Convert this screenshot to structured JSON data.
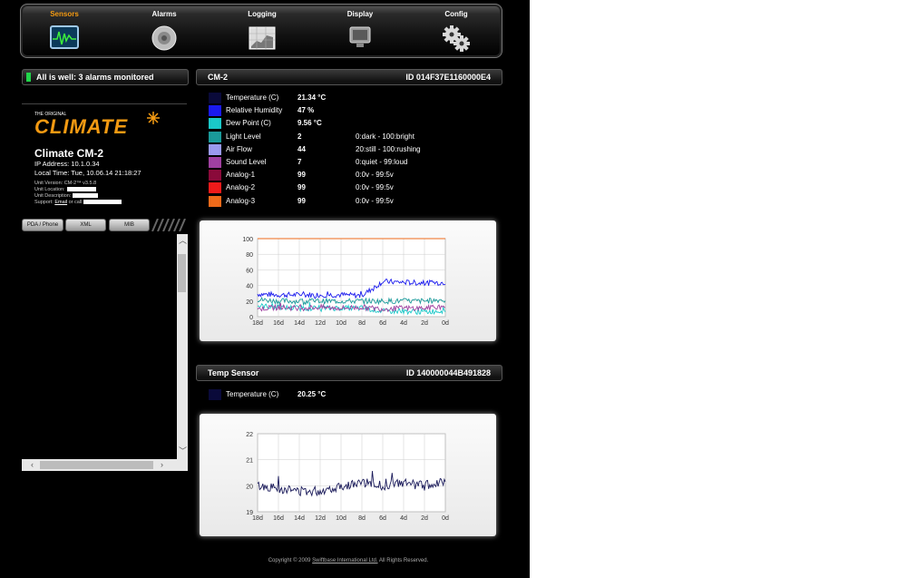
{
  "nav": {
    "items": [
      {
        "label": "Sensors",
        "icon": "sensor-graph-icon",
        "active": true
      },
      {
        "label": "Alarms",
        "icon": "alarm-bell-icon",
        "active": false
      },
      {
        "label": "Logging",
        "icon": "logging-chart-icon",
        "active": false
      },
      {
        "label": "Display",
        "icon": "display-monitor-icon",
        "active": false
      },
      {
        "label": "Config",
        "icon": "gears-icon",
        "active": false
      }
    ],
    "active_color": "#f39a12"
  },
  "status": {
    "text": "All is well: 3 alarms monitored",
    "led_color": "#21d44a"
  },
  "device": {
    "logo_small": "THE ORIGINAL",
    "logo": "CLIMATE",
    "name": "Climate CM-2",
    "ip": "IP Address: 10.1.0.34",
    "time": "Local Time: Tue, 10.06.14 21:18:27",
    "version": "Unit Version: CM-2™ v3.5.8",
    "location_label": "Unit Location:",
    "description_label": "Unit Description:",
    "support_pre": "Support:",
    "support_link": "Email",
    "support_post": "or call"
  },
  "buttons": {
    "pda": "PDA / Phone",
    "xml": "XML",
    "mib": "MIB"
  },
  "sensor1": {
    "name": "CM-2",
    "id": "ID 014F37E1160000E4",
    "rows": [
      {
        "label": "Temperature (C)",
        "value": "21.34 °C",
        "range": "",
        "color": "#0a0a3a"
      },
      {
        "label": "Relative Humidity",
        "value": "47 %",
        "range": "",
        "color": "#1a1aee"
      },
      {
        "label": "Dew Point (C)",
        "value": "9.56 °C",
        "range": "",
        "color": "#1ac8c8"
      },
      {
        "label": "Light Level",
        "value": "2",
        "range": "0:dark - 100:bright",
        "color": "#1a9a9a"
      },
      {
        "label": "Air Flow",
        "value": "44",
        "range": "20:still - 100:rushing",
        "color": "#9a9aee"
      },
      {
        "label": "Sound Level",
        "value": "7",
        "range": "0:quiet - 99:loud",
        "color": "#a040a0"
      },
      {
        "label": "Analog-1",
        "value": "99",
        "range": "0:0v - 99:5v",
        "color": "#8a0a3a"
      },
      {
        "label": "Analog-2",
        "value": "99",
        "range": "0:0v - 99:5v",
        "color": "#ee1a1a"
      },
      {
        "label": "Analog-3",
        "value": "99",
        "range": "0:0v - 99:5v",
        "color": "#ee6a1a"
      }
    ]
  },
  "sensor2": {
    "name": "Temp Sensor",
    "id": "ID 140000044B491828",
    "rows": [
      {
        "label": "Temperature (C)",
        "value": "20.25 °C",
        "range": "",
        "color": "#0a0a3a"
      }
    ]
  },
  "chart_data": [
    {
      "type": "line",
      "title": "",
      "x": [
        "18d",
        "16d",
        "14d",
        "12d",
        "10d",
        "8d",
        "6d",
        "4d",
        "2d",
        "0d"
      ],
      "ylim": [
        0,
        100
      ],
      "yticks": [
        0,
        20,
        40,
        60,
        80,
        100
      ],
      "grid": true,
      "series": [
        {
          "color": "#ee6a1a",
          "values": [
            100,
            100,
            100,
            100,
            100,
            100,
            100,
            100,
            100,
            100
          ]
        },
        {
          "color": "#1a1aee",
          "values": [
            29,
            28,
            28,
            28,
            28,
            27,
            45,
            44,
            43,
            44
          ]
        },
        {
          "color": "#1a9a9a",
          "values": [
            22,
            20,
            20,
            20,
            20,
            20,
            20,
            20,
            20,
            22
          ]
        },
        {
          "color": "#1ac8c8",
          "values": [
            14,
            12,
            11,
            11,
            11,
            11,
            7,
            7,
            6,
            8
          ]
        },
        {
          "color": "#a040a0",
          "values": [
            10,
            12,
            11,
            12,
            11,
            12,
            10,
            11,
            11,
            12
          ]
        }
      ]
    },
    {
      "type": "line",
      "title": "",
      "x": [
        "18d",
        "16d",
        "14d",
        "12d",
        "10d",
        "8d",
        "6d",
        "4d",
        "2d",
        "0d"
      ],
      "ylim": [
        19,
        22
      ],
      "yticks": [
        19,
        20,
        21,
        22
      ],
      "grid": true,
      "series": [
        {
          "color": "#1a1a5a",
          "values": [
            20.0,
            19.9,
            19.8,
            19.8,
            20.0,
            20.1,
            20.0,
            20.1,
            20.0,
            20.2
          ]
        }
      ]
    }
  ],
  "footer": {
    "pre": "Copyright © 2009",
    "link": "Swiftbase International Ltd.",
    "post": "All Rights Reserved."
  }
}
